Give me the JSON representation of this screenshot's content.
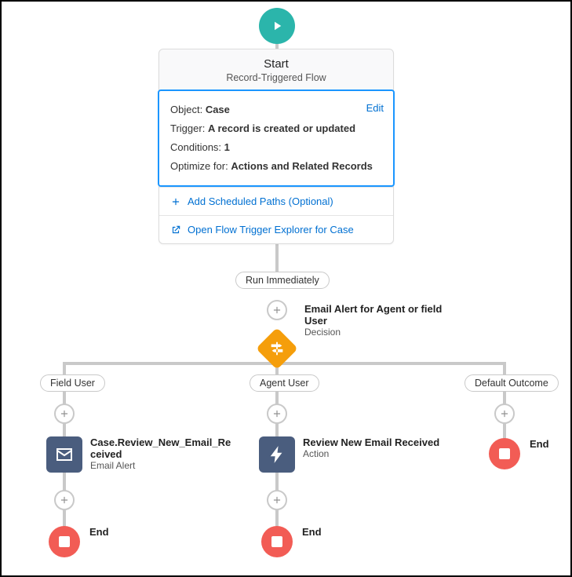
{
  "start": {
    "title": "Start",
    "subtitle": "Record-Triggered Flow",
    "edit": "Edit",
    "details": {
      "object_label": "Object:",
      "object_value": "Case",
      "trigger_label": "Trigger:",
      "trigger_value": "A record is created or updated",
      "conditions_label": "Conditions:",
      "conditions_value": "1",
      "optimize_label": "Optimize for:",
      "optimize_value": "Actions and Related Records"
    },
    "add_scheduled": "Add Scheduled Paths (Optional)",
    "open_explorer": "Open Flow Trigger Explorer for Case"
  },
  "run_immediately": "Run Immediately",
  "decision": {
    "title": "Email Alert for Agent or field User",
    "type": "Decision"
  },
  "branches": {
    "left": {
      "label": "Field User",
      "node": {
        "title": "Case.Review_New_Email_Received",
        "type": "Email Alert"
      },
      "end": "End"
    },
    "middle": {
      "label": "Agent User",
      "node": {
        "title": "Review New Email Received",
        "type": "Action"
      },
      "end": "End"
    },
    "right": {
      "label": "Default Outcome",
      "end": "End"
    }
  }
}
